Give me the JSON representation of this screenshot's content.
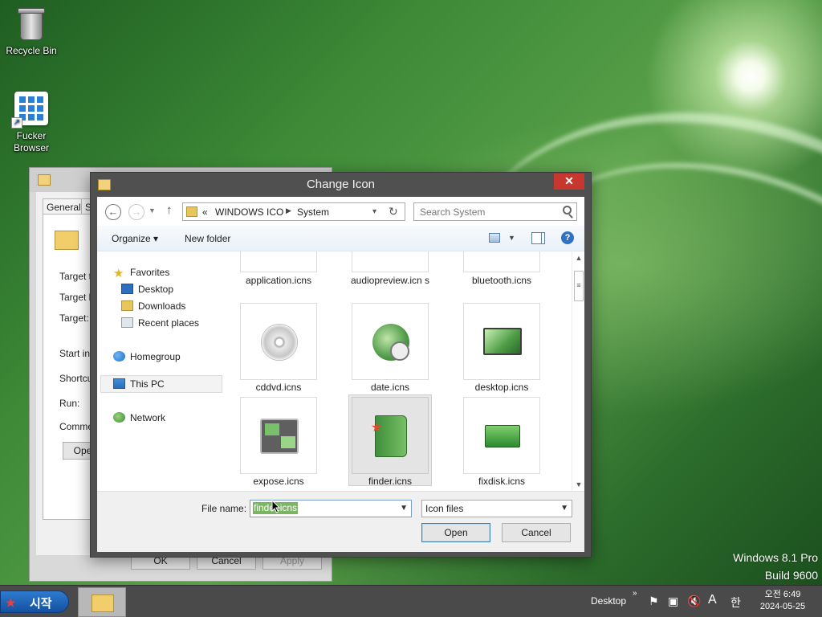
{
  "desktop": {
    "icons": [
      {
        "label": "Recycle Bin"
      },
      {
        "label": "Fucker Browser"
      }
    ],
    "watermark": {
      "line1": "Windows 8.1 Pro",
      "line2": "Build 9600"
    }
  },
  "properties_window": {
    "tabs": [
      "General",
      "S"
    ],
    "labels": [
      "Target ty",
      "Target lo",
      "Target:",
      "Start in:",
      "Shortcut",
      "Run:",
      "Commen"
    ],
    "open_button": "Ope",
    "buttons": {
      "ok": "OK",
      "cancel": "Cancel",
      "apply": "Apply"
    }
  },
  "dialog": {
    "title": "Change Icon",
    "close_glyph": "✕",
    "address": {
      "prefix": "«",
      "crumbs": [
        "WINDOWS ICO",
        "System"
      ]
    },
    "search_placeholder": "Search System",
    "toolbar": {
      "organize": "Organize ▾",
      "new_folder": "New folder",
      "help": "?"
    },
    "nav": {
      "favorites": "Favorites",
      "desktop": "Desktop",
      "downloads": "Downloads",
      "recent": "Recent places",
      "homegroup": "Homegroup",
      "thispc": "This PC",
      "network": "Network"
    },
    "files": {
      "row0": [
        "application.icns",
        "audiopreview.icn s",
        "bluetooth.icns"
      ],
      "row1": [
        "cddvd.icns",
        "date.icns",
        "desktop.icns"
      ],
      "row2": [
        "expose.icns",
        "finder.icns",
        "fixdisk.icns"
      ]
    },
    "selected_file": "finder.icns",
    "file_name_label": "File name:",
    "file_name_value": "finder.icns",
    "file_type_value": "Icon files",
    "buttons": {
      "open": "Open",
      "cancel": "Cancel"
    }
  },
  "taskbar": {
    "start_label": "시작",
    "desktop_label": "Desktop",
    "ime_a": "A",
    "ime_han": "한",
    "clock_time": "오전 6:49",
    "clock_date": "2024-05-25"
  },
  "colors": {
    "accent_close": "#c7372f",
    "selection": "#7ab563",
    "start_blue": "#1550a0"
  }
}
